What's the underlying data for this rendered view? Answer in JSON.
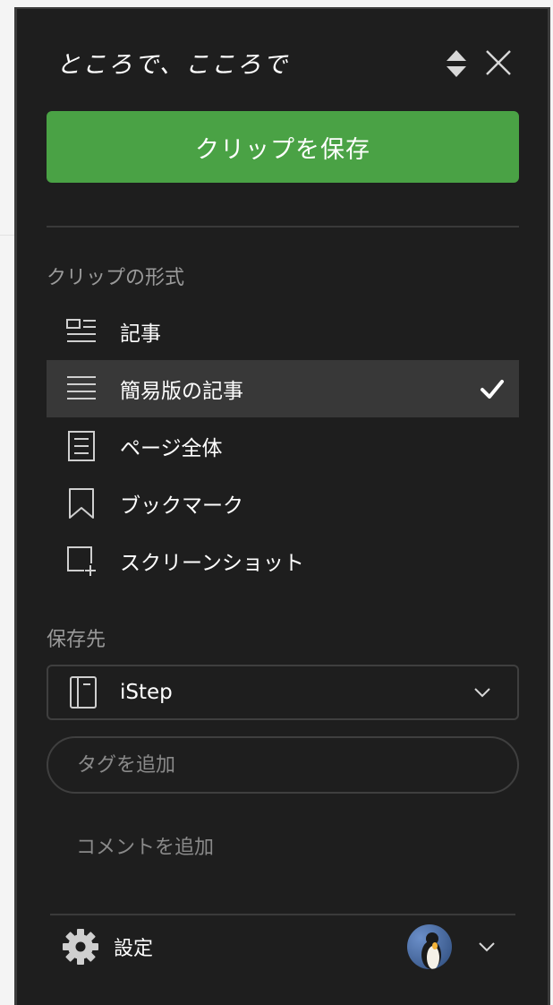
{
  "header": {
    "title": "ところで、こころで",
    "sort_icon": "up-down-arrows-icon",
    "close_icon": "close-icon"
  },
  "save_button": {
    "label": "クリップを保存",
    "color": "#4aa245"
  },
  "clip_format": {
    "label": "クリップの形式",
    "options": [
      {
        "label": "記事",
        "icon": "article-icon",
        "selected": false
      },
      {
        "label": "簡易版の記事",
        "icon": "simplified-article-icon",
        "selected": true
      },
      {
        "label": "ページ全体",
        "icon": "full-page-icon",
        "selected": false
      },
      {
        "label": "ブックマーク",
        "icon": "bookmark-icon",
        "selected": false
      },
      {
        "label": "スクリーンショット",
        "icon": "screenshot-icon",
        "selected": false
      }
    ]
  },
  "destination": {
    "label": "保存先",
    "notebook": "iStep",
    "notebook_icon": "notebook-icon"
  },
  "tag": {
    "placeholder": "タグを追加"
  },
  "comment": {
    "placeholder": "コメントを追加"
  },
  "footer": {
    "settings_label": "設定",
    "settings_icon": "gear-icon",
    "avatar": "penguin-avatar"
  }
}
